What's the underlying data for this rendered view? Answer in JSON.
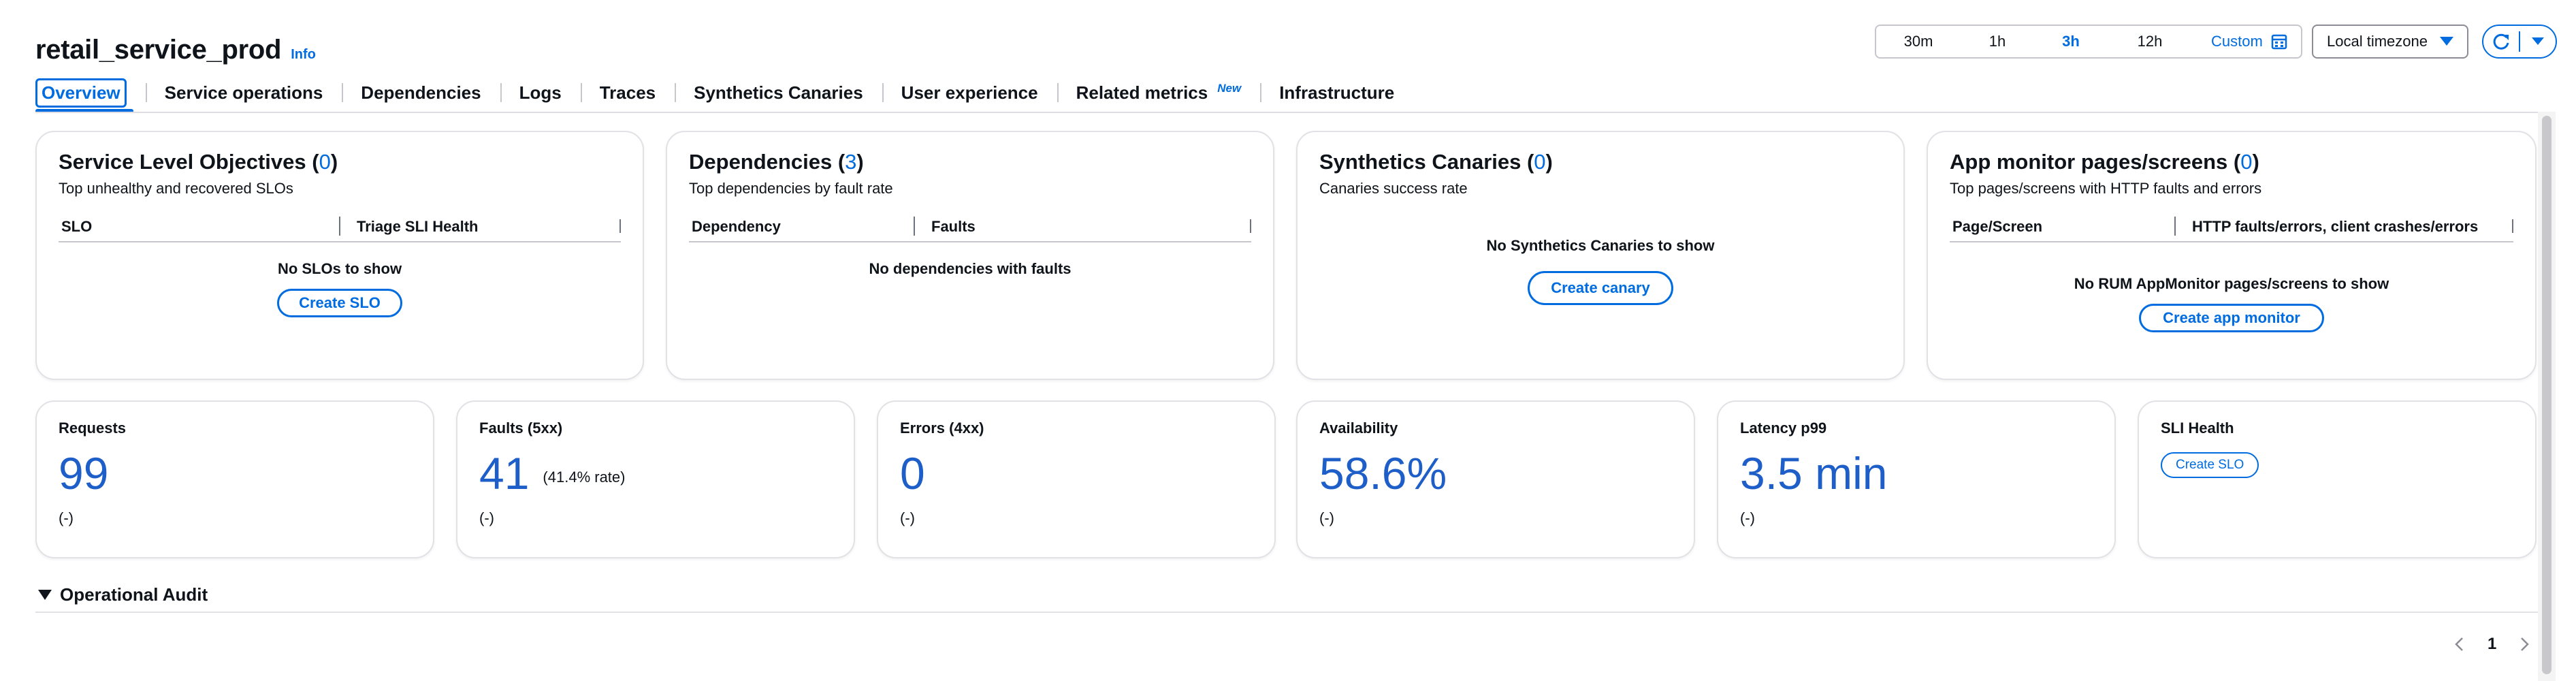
{
  "header": {
    "title": "retail_service_prod",
    "info_link": "Info"
  },
  "time_range": {
    "options": [
      "30m",
      "1h",
      "3h",
      "12h"
    ],
    "selected": "3h",
    "custom_label": "Custom",
    "timezone": "Local timezone"
  },
  "tabs": [
    {
      "label": "Overview",
      "active": true
    },
    {
      "label": "Service operations"
    },
    {
      "label": "Dependencies"
    },
    {
      "label": "Logs"
    },
    {
      "label": "Traces"
    },
    {
      "label": "Synthetics Canaries"
    },
    {
      "label": "User experience"
    },
    {
      "label": "Related metrics",
      "badge": "New"
    },
    {
      "label": "Infrastructure"
    }
  ],
  "panels": {
    "slo": {
      "title": "Service Level Objectives",
      "count": "0",
      "subtitle": "Top unhealthy and recovered SLOs",
      "columns": [
        "SLO",
        "Triage SLI Health"
      ],
      "empty": "No SLOs to show",
      "button": "Create SLO"
    },
    "dependencies": {
      "title": "Dependencies",
      "count": "3",
      "subtitle": "Top dependencies by fault rate",
      "columns": [
        "Dependency",
        "Faults"
      ],
      "empty": "No dependencies with faults"
    },
    "canaries": {
      "title": "Synthetics Canaries",
      "count": "0",
      "subtitle": "Canaries success rate",
      "empty": "No Synthetics Canaries to show",
      "button": "Create canary"
    },
    "app_monitor": {
      "title": "App monitor pages/screens",
      "count": "0",
      "subtitle": "Top pages/screens with HTTP faults and errors",
      "columns": [
        "Page/Screen",
        "HTTP faults/errors, client crashes/errors"
      ],
      "empty": "No RUM AppMonitor pages/screens to show",
      "button": "Create app monitor"
    }
  },
  "metrics": {
    "requests": {
      "label": "Requests",
      "value": "99",
      "delta": "(-)"
    },
    "faults": {
      "label": "Faults (5xx)",
      "value": "41",
      "rate": "(41.4% rate)",
      "delta": "(-)"
    },
    "errors": {
      "label": "Errors (4xx)",
      "value": "0",
      "delta": "(-)"
    },
    "availability": {
      "label": "Availability",
      "value": "58.6%",
      "delta": "(-)"
    },
    "latency": {
      "label": "Latency p99",
      "value": "3.5 min",
      "delta": "(-)"
    },
    "sli_health": {
      "label": "SLI Health",
      "button": "Create SLO"
    }
  },
  "audit": {
    "label": "Operational Audit"
  },
  "pagination": {
    "current_page": "1"
  },
  "colors": {
    "accent": "#006ce0",
    "metric_value": "#1e5ec8",
    "border": "#e1e1e6"
  }
}
